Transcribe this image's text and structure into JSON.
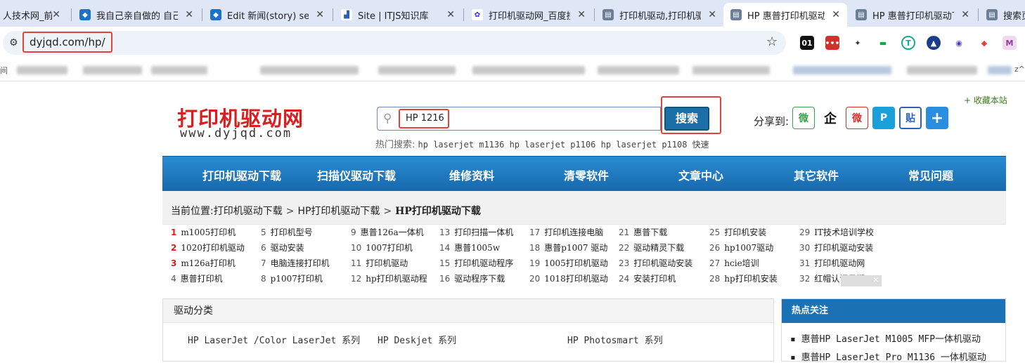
{
  "tabs": [
    {
      "label": "人技术网_前",
      "icon": "tab-favicon"
    },
    {
      "label": "我自己亲自做的 自己",
      "icon": "drupal-icon"
    },
    {
      "label": "Edit 新闻(story) self",
      "icon": "drupal-icon"
    },
    {
      "label": "Site | ITJS知识库",
      "icon": "chart-icon"
    },
    {
      "label": "打印机驱动网_百度搜",
      "icon": "baidu-icon"
    },
    {
      "label": "打印机驱动,打印机驱",
      "icon": "printer-icon"
    },
    {
      "label": "HP 惠普打印机驱动下",
      "icon": "printer-icon"
    },
    {
      "label": "HP 惠普打印机驱动下",
      "icon": "printer-icon"
    },
    {
      "label": "搜索页",
      "icon": "printer-icon"
    }
  ],
  "address": {
    "url": "dyjqd.com/hp/"
  },
  "extensions": [
    "01",
    "•••",
    "✦",
    "▬",
    "T",
    "▲",
    "◉",
    "◆",
    "M"
  ],
  "bookmarks": {
    "left_text": "间",
    "right_text": "z^"
  },
  "site": {
    "logo_cn": "打印机驱动网",
    "logo_en": "www.dyjqd.com",
    "search_value": "HP 1216",
    "search_button": "搜索",
    "hot_label": "热门搜索:",
    "hot_keywords": "hp laserjet m1136 hp laserjet p1106 hp laserjet p1108 快速",
    "share_label": "分享到:",
    "favorite": "+ 收藏本站",
    "share_icons": [
      "微",
      "企",
      "微",
      "P",
      "贴",
      "+"
    ]
  },
  "nav": [
    "打印机驱动下载",
    "扫描仪驱动下载",
    "维修资料",
    "清零软件",
    "文章中心",
    "其它软件",
    "常见问题"
  ],
  "breadcrumb": {
    "label": "当前位置:",
    "items": [
      "打印机驱动下载",
      "HP打印机驱动下载"
    ],
    "current": "HP打印机驱动下载"
  },
  "keywords": [
    {
      "n": "1",
      "t": "m1005打印机"
    },
    {
      "n": "2",
      "t": "1020打印机驱动"
    },
    {
      "n": "3",
      "t": "m126a打印机"
    },
    {
      "n": "4",
      "t": "惠普打印机"
    },
    {
      "n": "5",
      "t": "打印机型号"
    },
    {
      "n": "6",
      "t": "驱动安装"
    },
    {
      "n": "7",
      "t": "电脑连接打印机"
    },
    {
      "n": "8",
      "t": "p1007打印机"
    },
    {
      "n": "9",
      "t": "惠普126a一体机"
    },
    {
      "n": "10",
      "t": "1007打印机"
    },
    {
      "n": "11",
      "t": "打印机驱动"
    },
    {
      "n": "12",
      "t": "hp打印机驱动程"
    },
    {
      "n": "13",
      "t": "打印扫描一体机"
    },
    {
      "n": "14",
      "t": "惠普1005w"
    },
    {
      "n": "15",
      "t": "打印机驱动程序"
    },
    {
      "n": "16",
      "t": "驱动程序下载"
    },
    {
      "n": "17",
      "t": "打印机连接电脑"
    },
    {
      "n": "18",
      "t": "惠普p1007 驱动"
    },
    {
      "n": "19",
      "t": "1005打印机驱动"
    },
    {
      "n": "20",
      "t": "1018打印机驱动"
    },
    {
      "n": "21",
      "t": "惠普下载"
    },
    {
      "n": "22",
      "t": "驱动精灵下载"
    },
    {
      "n": "23",
      "t": "打印机驱动安装"
    },
    {
      "n": "24",
      "t": "安装打印机"
    },
    {
      "n": "25",
      "t": "打印机安装"
    },
    {
      "n": "26",
      "t": "hp1007驱动"
    },
    {
      "n": "27",
      "t": "hcie培训"
    },
    {
      "n": "28",
      "t": "hp打印机安装"
    },
    {
      "n": "29",
      "t": "IT技术培训学校"
    },
    {
      "n": "30",
      "t": "打印机驱动安装"
    },
    {
      "n": "31",
      "t": "打印机驱动网"
    },
    {
      "n": "32",
      "t": "红帽认证日期"
    }
  ],
  "panel_left": {
    "title": "驱动分类",
    "categories": [
      "HP LaserJet /Color LaserJet 系列",
      "HP Deskjet 系列",
      "HP Photosmart 系列"
    ]
  },
  "panel_right": {
    "title": "热点关注",
    "items": [
      "惠普HP LaserJet M1005 MFP一体机驱动",
      "惠普HP LaserJet Pro M1136 一体机驱动"
    ]
  },
  "colors": {
    "accent_red": "#e0443a",
    "nav_blue": "#1c6fa6",
    "logo_red": "#d81e1e"
  }
}
